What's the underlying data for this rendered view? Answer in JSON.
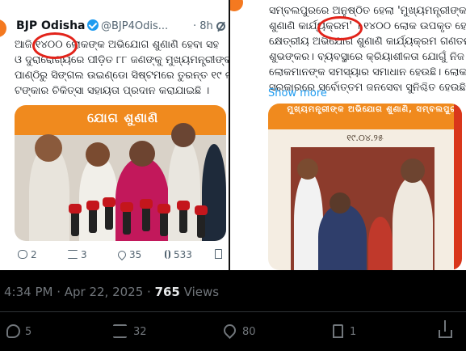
{
  "left_tweet": {
    "author_name": "BJP Odisha",
    "handle": "@BJP4Odis...",
    "time": "· 8h",
    "text_lines": [
      "ଆଜି ୧୪୦୦ ଲୋକଙ୍କ ଅଭିଯୋଗ ଶୁଣାଣି ହେବା ସହ ",
      "ଓ ଦୁରାରୋଗ୍ୟରେ ପୀଡ଼ିତ ୮୮ ଜଣଙ୍କୁ ମୁଖ୍ୟମନ୍ତ୍ରୀଙ୍କ ରି",
      "ପାଣ୍ଠିରୁ ସିଙ୍ଗଲ ଉଇଣ୍ଡୋ ସିଷ୍ଟମରେ ତୁରନ୍ତ ୧୯ ଲକ୍ଷ ୫୦ ହ",
      "ଟଙ୍କାର ଚିକିତ୍ସା ସହାୟତା ପ୍ରଦାନ କରାଯାଇଛି ।"
    ],
    "banner_text": "ଯୋଗ ଶୁଣାଣି",
    "actions": {
      "replies": "2",
      "reposts": "3",
      "likes": "35",
      "views": "533"
    }
  },
  "right_tweet": {
    "text_lines": [
      "ସମ୍ବଲପୁରରେ ଅନୁଷ୍ଠିତ ହେଲା 'ମୁଖ୍ୟମନ୍ତ୍ରୀଙ୍କ ଅଭିଯୋଗ",
      "ଶୁଣାଣି କାର୍ଯ୍ୟକ୍ରମ' । ୧୪୦୦ ଲୋକ ଉପକୃତ ହେଲେ।",
      "କ୍ଷେତ୍ରୀୟ ଅଭିଯୋଗ ଶୁଣାଣି କାର୍ଯ୍ୟକ୍ରମ ଗଣତନ୍ତ୍ର ପାଇଁ",
      "ଶୁଭଙ୍କର। ବ୍ୟବସ୍ଥାରେ କ୍ରିୟାଶୀଳତା ଯୋଗୁଁ ନିଜ ଅଞ୍ଚଳରେ ହିଁ",
      "ଲୋକମାନଙ୍କ ସମସ୍ୟାର ସମାଧାନ ହେଉଛି। ଲୋକଙ୍କ",
      "ସରକାରରେ ସର୍ବୋତ୍ତମ ଜନସେବା ସୁନିଶ୍ଚିତ ହେଉଛି।"
    ],
    "show_more": "Show more",
    "poster_title": "ମୁଖ୍ୟମନ୍ତ୍ରୀଙ୍କ ଅଭିଯୋଗ ଶୁଣାଣି, ସମ୍ବଲପୁର",
    "poster_date": "୧୯.୦୪.୨୫"
  },
  "meta": {
    "timestamp": "4:34 PM · Apr 22, 2025 · ",
    "views_count": "765",
    "views_label": " Views"
  },
  "bottom_actions": {
    "replies": "5",
    "reposts": "32",
    "likes": "80",
    "bookmarks": "1"
  },
  "colors": {
    "accent": "#1d9bf0",
    "highlight_circle": "#e2231a",
    "banner_orange": "#f08a1e"
  }
}
